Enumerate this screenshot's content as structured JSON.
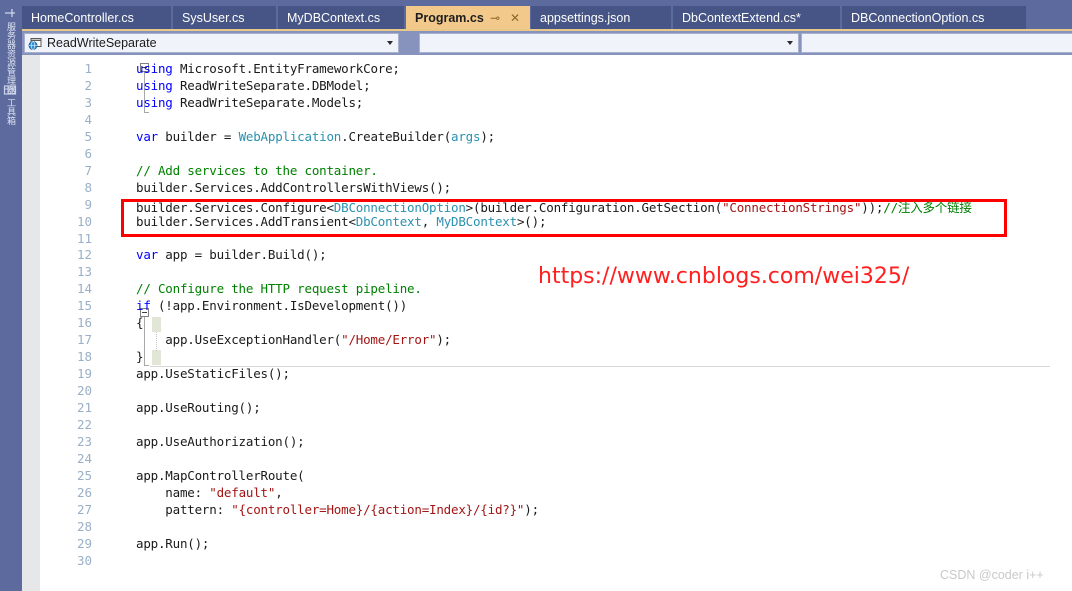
{
  "window": {
    "left_strip": {
      "tabs": [
        {
          "name": "server-explorer",
          "label": "服务器资源管理器"
        },
        {
          "name": "toolbox",
          "label": "工具箱"
        }
      ]
    }
  },
  "tabstrip": {
    "tabs": [
      {
        "label": "HomeController.cs",
        "active": false,
        "modified": false
      },
      {
        "label": "SysUser.cs",
        "active": false,
        "modified": false
      },
      {
        "label": "MyDBContext.cs",
        "active": false,
        "modified": false
      },
      {
        "label": "Program.cs",
        "active": true,
        "modified": false,
        "pin_icon": "⊸",
        "close_icon": "✕"
      },
      {
        "label": "appsettings.json",
        "active": false,
        "modified": false
      },
      {
        "label": "DbContextExtend.cs*",
        "active": false,
        "modified": true
      },
      {
        "label": "DBConnectionOption.cs",
        "active": false,
        "modified": false
      }
    ]
  },
  "navbar": {
    "project_combo": {
      "value": "ReadWriteSeparate",
      "icon": "project-globe-icon"
    },
    "type_combo": {
      "value": ""
    },
    "member_combo": {
      "value": ""
    }
  },
  "editor": {
    "line_numbers": [
      "1",
      "2",
      "3",
      "4",
      "5",
      "6",
      "7",
      "8",
      "9",
      "10",
      "11",
      "12",
      "13",
      "14",
      "15",
      "16",
      "17",
      "18",
      "19",
      "20",
      "21",
      "22",
      "23",
      "24",
      "25",
      "26",
      "27",
      "28",
      "29",
      "30"
    ],
    "lines": [
      {
        "n": 1,
        "tokens": [
          {
            "t": "using",
            "c": "k"
          },
          {
            "t": " Microsoft",
            "c": "p"
          },
          {
            "t": ".EntityFrameworkCore;",
            "c": "p"
          }
        ]
      },
      {
        "n": 2,
        "tokens": [
          {
            "t": "using",
            "c": "k"
          },
          {
            "t": " ReadWriteSeparate.DBModel;",
            "c": "p"
          }
        ]
      },
      {
        "n": 3,
        "tokens": [
          {
            "t": "using",
            "c": "k"
          },
          {
            "t": " ReadWriteSeparate.Models;",
            "c": "p"
          }
        ]
      },
      {
        "n": 4,
        "tokens": []
      },
      {
        "n": 5,
        "tokens": [
          {
            "t": "var",
            "c": "k"
          },
          {
            "t": " builder = ",
            "c": "p"
          },
          {
            "t": "WebApplication",
            "c": "ty"
          },
          {
            "t": ".CreateBuilder(",
            "c": "p"
          },
          {
            "t": "args",
            "c": "ty"
          },
          {
            "t": ");",
            "c": "p"
          }
        ]
      },
      {
        "n": 6,
        "tokens": []
      },
      {
        "n": 7,
        "tokens": [
          {
            "t": "// Add services to the container.",
            "c": "c"
          }
        ]
      },
      {
        "n": 8,
        "tokens": [
          {
            "t": "builder.Services.AddControllersWithViews();",
            "c": "p"
          }
        ]
      },
      {
        "n": 9,
        "tokens": [
          {
            "t": "builder.Services.Configure<",
            "c": "p"
          },
          {
            "t": "DBConnectionOption",
            "c": "ty"
          },
          {
            "t": ">(builder.Configuration.GetSection(",
            "c": "p"
          },
          {
            "t": "\"ConnectionStrings\"",
            "c": "s"
          },
          {
            "t": "));",
            "c": "p"
          },
          {
            "t": "//注入多个链接",
            "c": "c"
          }
        ]
      },
      {
        "n": 10,
        "tokens": [
          {
            "t": "builder.Services.AddTransient<",
            "c": "p"
          },
          {
            "t": "DbContext",
            "c": "ty"
          },
          {
            "t": ", ",
            "c": "p"
          },
          {
            "t": "MyDBContext",
            "c": "ty"
          },
          {
            "t": ">();",
            "c": "p"
          }
        ]
      },
      {
        "n": 11,
        "tokens": []
      },
      {
        "n": 12,
        "tokens": [
          {
            "t": "var",
            "c": "k"
          },
          {
            "t": " app = builder.Build();",
            "c": "p"
          }
        ]
      },
      {
        "n": 13,
        "tokens": []
      },
      {
        "n": 14,
        "tokens": [
          {
            "t": "// Configure the HTTP request pipeline.",
            "c": "c"
          }
        ]
      },
      {
        "n": 15,
        "tokens": [
          {
            "t": "if",
            "c": "k"
          },
          {
            "t": " (!app.Environment.IsDevelopment())",
            "c": "p"
          }
        ]
      },
      {
        "n": 16,
        "tokens": [
          {
            "t": "{",
            "c": "p"
          }
        ]
      },
      {
        "n": 17,
        "tokens": [
          {
            "t": "    app.UseExceptionHandler(",
            "c": "p"
          },
          {
            "t": "\"/Home/Error\"",
            "c": "s"
          },
          {
            "t": ");",
            "c": "p"
          }
        ]
      },
      {
        "n": 18,
        "tokens": [
          {
            "t": "}",
            "c": "p"
          }
        ]
      },
      {
        "n": 19,
        "tokens": [
          {
            "t": "app.UseStaticFiles();",
            "c": "p"
          }
        ]
      },
      {
        "n": 20,
        "tokens": []
      },
      {
        "n": 21,
        "tokens": [
          {
            "t": "app.UseRouting();",
            "c": "p"
          }
        ]
      },
      {
        "n": 22,
        "tokens": []
      },
      {
        "n": 23,
        "tokens": [
          {
            "t": "app.UseAuthorization();",
            "c": "p"
          }
        ]
      },
      {
        "n": 24,
        "tokens": []
      },
      {
        "n": 25,
        "tokens": [
          {
            "t": "app.MapControllerRoute(",
            "c": "p"
          }
        ]
      },
      {
        "n": 26,
        "tokens": [
          {
            "t": "    name: ",
            "c": "p"
          },
          {
            "t": "\"default\"",
            "c": "s"
          },
          {
            "t": ",",
            "c": "p"
          }
        ]
      },
      {
        "n": 27,
        "tokens": [
          {
            "t": "    pattern: ",
            "c": "p"
          },
          {
            "t": "\"{controller=Home}/{action=Index}/{id?}\"",
            "c": "s"
          },
          {
            "t": ");",
            "c": "p"
          }
        ]
      },
      {
        "n": 28,
        "tokens": []
      },
      {
        "n": 29,
        "tokens": [
          {
            "t": "app.Run();",
            "c": "p"
          }
        ]
      },
      {
        "n": 30,
        "tokens": []
      }
    ]
  },
  "annotations": {
    "red_box": {
      "label": "highlight-box",
      "color": "#ff0000"
    },
    "watermark_url": "https://www.cnblogs.com/wei325/",
    "watermark_color": "#ff2020",
    "footer": "CSDN @coder i++"
  }
}
